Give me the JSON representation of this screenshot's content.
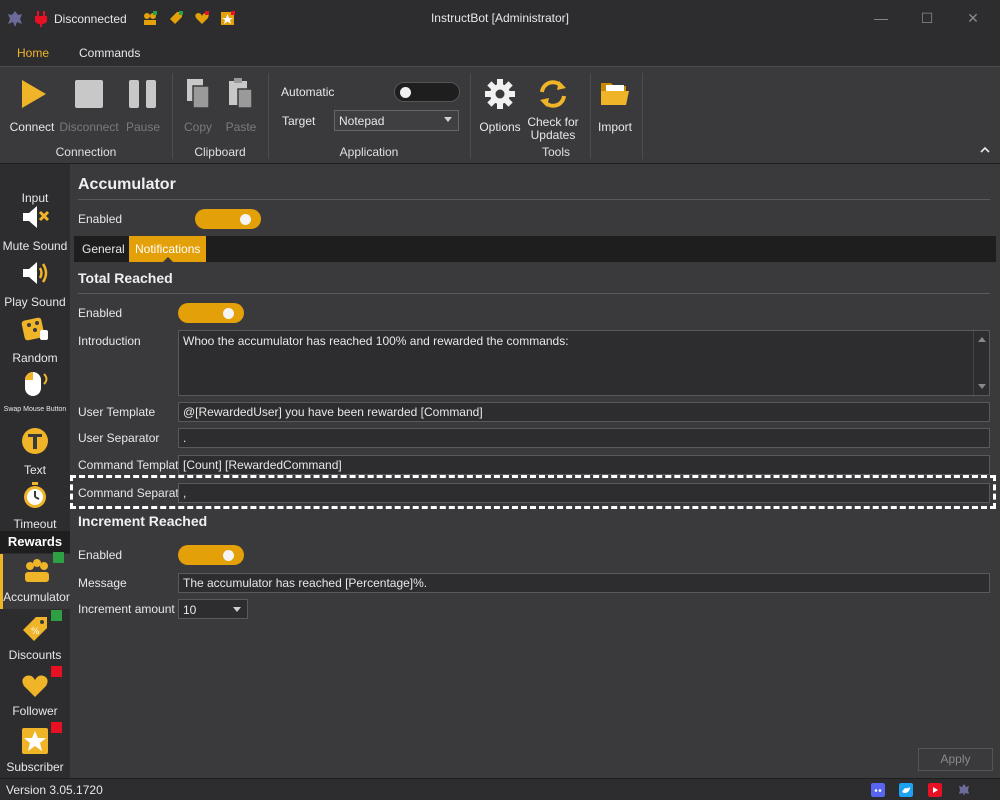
{
  "window": {
    "title": "InstructBot [Administrator]",
    "connection_status": "Disconnected"
  },
  "menu": {
    "tabs": [
      "Home",
      "Commands"
    ]
  },
  "ribbon": {
    "connect": "Connect",
    "disconnect": "Disconnect",
    "pause": "Pause",
    "copy": "Copy",
    "paste": "Paste",
    "automatic_label": "Automatic",
    "target_label": "Target",
    "target_value": "Notepad",
    "options": "Options",
    "check_updates_line1": "Check for",
    "check_updates_line2": "Updates",
    "import": "Import",
    "groups": {
      "connection": "Connection",
      "clipboard": "Clipboard",
      "application": "Application",
      "tools": "Tools"
    }
  },
  "sidebar": {
    "items": [
      {
        "label": "Input"
      },
      {
        "label": "Mute Sound"
      },
      {
        "label": "Play Sound"
      },
      {
        "label": "Random"
      },
      {
        "label": "Swap Mouse Button"
      },
      {
        "label": "Text"
      },
      {
        "label": "Timeout"
      }
    ],
    "rewards_heading": "Rewards",
    "rewards": [
      {
        "label": "Accumulator",
        "status_color": "#2ea043"
      },
      {
        "label": "Discounts",
        "status_color": "#2ea043"
      },
      {
        "label": "Follower",
        "status_color": "#e81123"
      },
      {
        "label": "Subscriber",
        "status_color": "#e81123"
      }
    ]
  },
  "main": {
    "title": "Accumulator",
    "enabled_label": "Enabled",
    "tabs": [
      "General",
      "Notifications"
    ],
    "total_reached": {
      "heading": "Total Reached",
      "enabled_label": "Enabled",
      "introduction_label": "Introduction",
      "introduction_value": "Whoo the accumulator has reached 100% and rewarded the commands:",
      "user_template_label": "User Template",
      "user_template_value": "@[RewardedUser]  you have been rewarded [Command]",
      "user_separator_label": "User Separator",
      "user_separator_value": ".",
      "command_template_label": "Command Template",
      "command_template_value": "[Count]  [RewardedCommand]",
      "command_separator_label": "Command Separator",
      "command_separator_value": ","
    },
    "increment_reached": {
      "heading": "Increment Reached",
      "enabled_label": "Enabled",
      "message_label": "Message",
      "message_value": "The accumulator has reached [Percentage]%.",
      "increment_amount_label": "Increment amount",
      "increment_amount_value": "10"
    },
    "apply": "Apply"
  },
  "status": {
    "version": "Version 3.05.1720"
  },
  "colors": {
    "accent": "#e3a008"
  }
}
